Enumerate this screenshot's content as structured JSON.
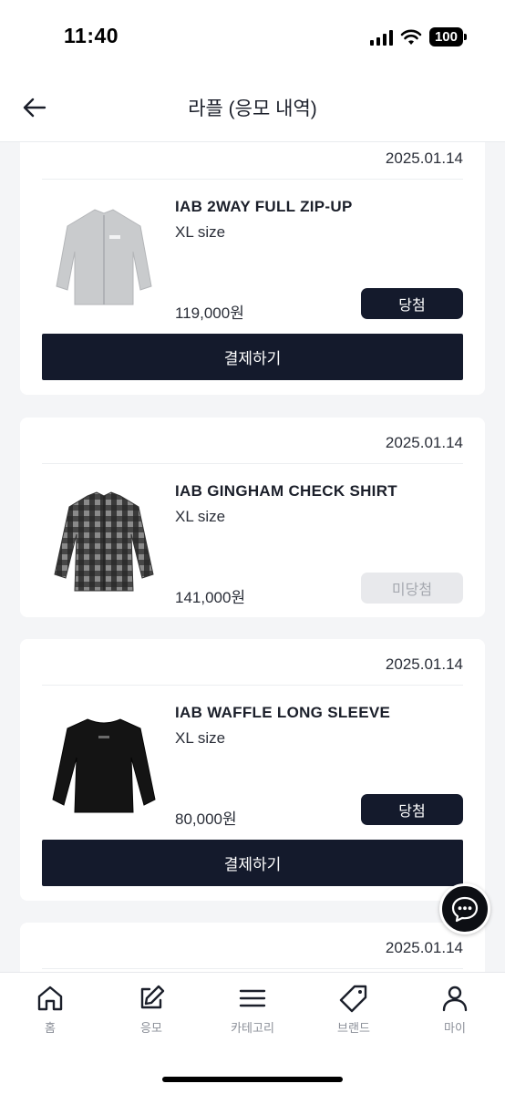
{
  "status_bar": {
    "time": "11:40",
    "battery": "100"
  },
  "header": {
    "title": "라플 (응모 내역)"
  },
  "raffles": [
    {
      "date": "2025.01.14",
      "name": "IAB 2WAY FULL ZIP-UP",
      "size": "XL size",
      "price": "119,000원",
      "status": "당첨",
      "pay_label": "결제하기"
    },
    {
      "date": "2025.01.14",
      "name": "IAB GINGHAM CHECK SHIRT",
      "size": "XL size",
      "price": "141,000원",
      "status": "미당첨"
    },
    {
      "date": "2025.01.14",
      "name": "IAB WAFFLE LONG SLEEVE",
      "size": "XL size",
      "price": "80,000원",
      "status": "당첨",
      "pay_label": "결제하기"
    },
    {
      "date": "2025.01.14"
    }
  ],
  "tabbar": {
    "items": [
      {
        "label": "홈",
        "icon": "home-icon"
      },
      {
        "label": "응모",
        "icon": "edit-icon"
      },
      {
        "label": "카테고리",
        "icon": "menu-icon"
      },
      {
        "label": "브랜드",
        "icon": "tag-icon"
      },
      {
        "label": "마이",
        "icon": "user-icon"
      }
    ]
  },
  "colors": {
    "primary": "#141a2c",
    "background": "#f4f5f7",
    "disabled": "#e8e9ec"
  }
}
